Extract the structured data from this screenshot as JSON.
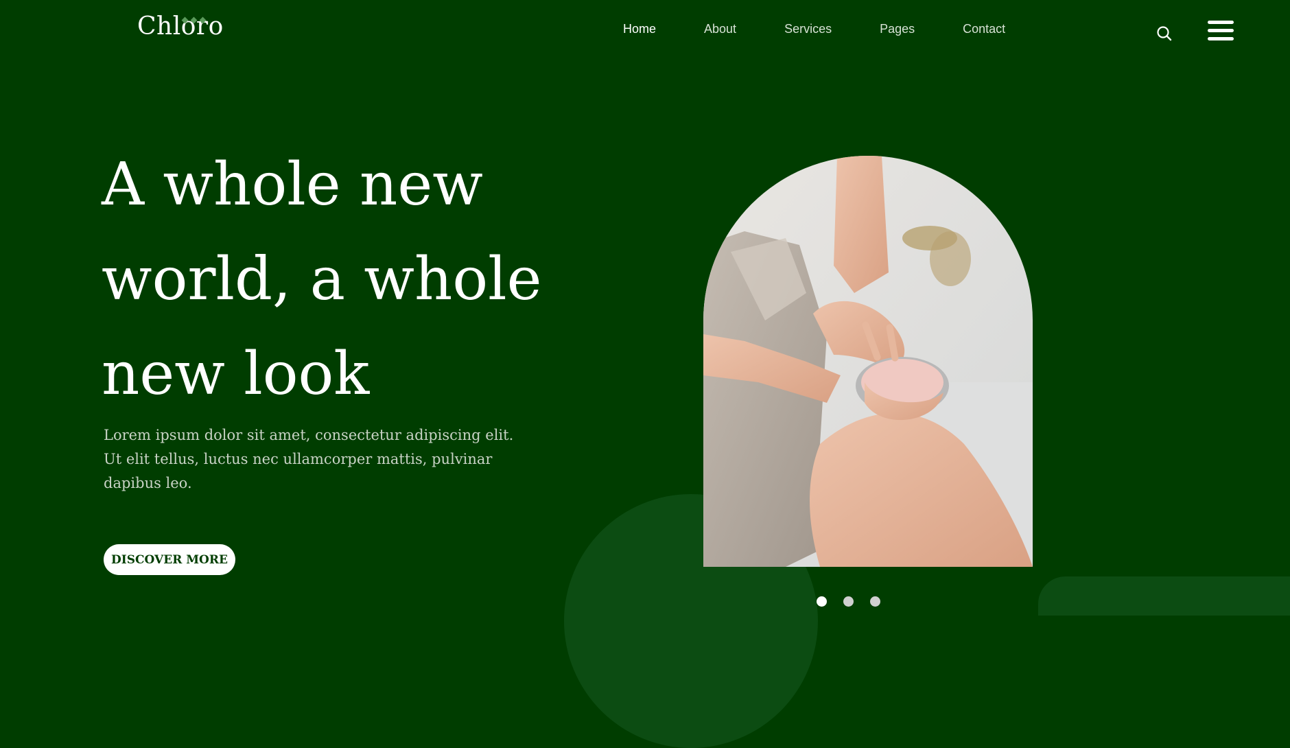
{
  "brand": {
    "name": "Chloro",
    "accent_color": "#5a9a5a"
  },
  "nav": {
    "items": [
      {
        "label": "Home",
        "active": true
      },
      {
        "label": "About",
        "active": false
      },
      {
        "label": "Services",
        "active": false
      },
      {
        "label": "Pages",
        "active": false
      },
      {
        "label": "Contact",
        "active": false
      }
    ]
  },
  "header_icons": {
    "search": "search-icon",
    "menu": "hamburger-menu-icon"
  },
  "hero": {
    "title": "A whole new world, a whole new look",
    "text": "Lorem ipsum dolor sit amet, consectetur adipiscing elit. Ut elit tellus, luctus nec ullamcorper mattis, pulvinar dapibus leo.",
    "cta_label": "DISCOVER MORE"
  },
  "slider": {
    "count": 3,
    "active_index": 0
  },
  "colors": {
    "background": "#003d00",
    "decoration": "#0c4c12",
    "text_muted": "#c9d3c6",
    "button_bg": "#ffffff",
    "button_text": "#003d00"
  }
}
